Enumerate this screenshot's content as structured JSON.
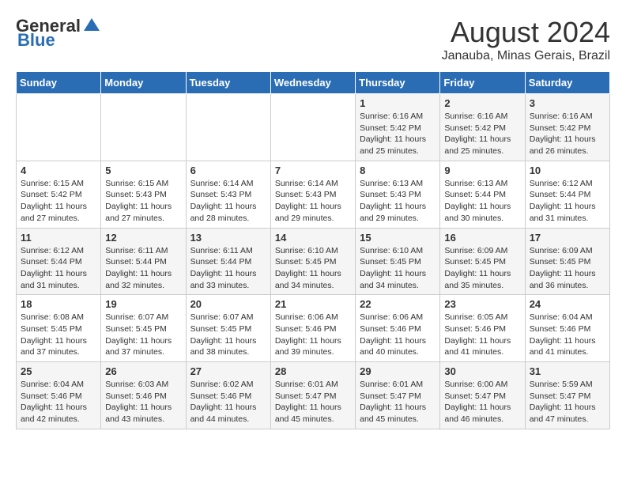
{
  "header": {
    "logo_general": "General",
    "logo_blue": "Blue",
    "month_year": "August 2024",
    "location": "Janauba, Minas Gerais, Brazil"
  },
  "days_of_week": [
    "Sunday",
    "Monday",
    "Tuesday",
    "Wednesday",
    "Thursday",
    "Friday",
    "Saturday"
  ],
  "weeks": [
    [
      {
        "day": "",
        "info": ""
      },
      {
        "day": "",
        "info": ""
      },
      {
        "day": "",
        "info": ""
      },
      {
        "day": "",
        "info": ""
      },
      {
        "day": "1",
        "info": "Sunrise: 6:16 AM\nSunset: 5:42 PM\nDaylight: 11 hours and 25 minutes."
      },
      {
        "day": "2",
        "info": "Sunrise: 6:16 AM\nSunset: 5:42 PM\nDaylight: 11 hours and 25 minutes."
      },
      {
        "day": "3",
        "info": "Sunrise: 6:16 AM\nSunset: 5:42 PM\nDaylight: 11 hours and 26 minutes."
      }
    ],
    [
      {
        "day": "4",
        "info": "Sunrise: 6:15 AM\nSunset: 5:42 PM\nDaylight: 11 hours and 27 minutes."
      },
      {
        "day": "5",
        "info": "Sunrise: 6:15 AM\nSunset: 5:43 PM\nDaylight: 11 hours and 27 minutes."
      },
      {
        "day": "6",
        "info": "Sunrise: 6:14 AM\nSunset: 5:43 PM\nDaylight: 11 hours and 28 minutes."
      },
      {
        "day": "7",
        "info": "Sunrise: 6:14 AM\nSunset: 5:43 PM\nDaylight: 11 hours and 29 minutes."
      },
      {
        "day": "8",
        "info": "Sunrise: 6:13 AM\nSunset: 5:43 PM\nDaylight: 11 hours and 29 minutes."
      },
      {
        "day": "9",
        "info": "Sunrise: 6:13 AM\nSunset: 5:44 PM\nDaylight: 11 hours and 30 minutes."
      },
      {
        "day": "10",
        "info": "Sunrise: 6:12 AM\nSunset: 5:44 PM\nDaylight: 11 hours and 31 minutes."
      }
    ],
    [
      {
        "day": "11",
        "info": "Sunrise: 6:12 AM\nSunset: 5:44 PM\nDaylight: 11 hours and 31 minutes."
      },
      {
        "day": "12",
        "info": "Sunrise: 6:11 AM\nSunset: 5:44 PM\nDaylight: 11 hours and 32 minutes."
      },
      {
        "day": "13",
        "info": "Sunrise: 6:11 AM\nSunset: 5:44 PM\nDaylight: 11 hours and 33 minutes."
      },
      {
        "day": "14",
        "info": "Sunrise: 6:10 AM\nSunset: 5:45 PM\nDaylight: 11 hours and 34 minutes."
      },
      {
        "day": "15",
        "info": "Sunrise: 6:10 AM\nSunset: 5:45 PM\nDaylight: 11 hours and 34 minutes."
      },
      {
        "day": "16",
        "info": "Sunrise: 6:09 AM\nSunset: 5:45 PM\nDaylight: 11 hours and 35 minutes."
      },
      {
        "day": "17",
        "info": "Sunrise: 6:09 AM\nSunset: 5:45 PM\nDaylight: 11 hours and 36 minutes."
      }
    ],
    [
      {
        "day": "18",
        "info": "Sunrise: 6:08 AM\nSunset: 5:45 PM\nDaylight: 11 hours and 37 minutes."
      },
      {
        "day": "19",
        "info": "Sunrise: 6:07 AM\nSunset: 5:45 PM\nDaylight: 11 hours and 37 minutes."
      },
      {
        "day": "20",
        "info": "Sunrise: 6:07 AM\nSunset: 5:45 PM\nDaylight: 11 hours and 38 minutes."
      },
      {
        "day": "21",
        "info": "Sunrise: 6:06 AM\nSunset: 5:46 PM\nDaylight: 11 hours and 39 minutes."
      },
      {
        "day": "22",
        "info": "Sunrise: 6:06 AM\nSunset: 5:46 PM\nDaylight: 11 hours and 40 minutes."
      },
      {
        "day": "23",
        "info": "Sunrise: 6:05 AM\nSunset: 5:46 PM\nDaylight: 11 hours and 41 minutes."
      },
      {
        "day": "24",
        "info": "Sunrise: 6:04 AM\nSunset: 5:46 PM\nDaylight: 11 hours and 41 minutes."
      }
    ],
    [
      {
        "day": "25",
        "info": "Sunrise: 6:04 AM\nSunset: 5:46 PM\nDaylight: 11 hours and 42 minutes."
      },
      {
        "day": "26",
        "info": "Sunrise: 6:03 AM\nSunset: 5:46 PM\nDaylight: 11 hours and 43 minutes."
      },
      {
        "day": "27",
        "info": "Sunrise: 6:02 AM\nSunset: 5:46 PM\nDaylight: 11 hours and 44 minutes."
      },
      {
        "day": "28",
        "info": "Sunrise: 6:01 AM\nSunset: 5:47 PM\nDaylight: 11 hours and 45 minutes."
      },
      {
        "day": "29",
        "info": "Sunrise: 6:01 AM\nSunset: 5:47 PM\nDaylight: 11 hours and 45 minutes."
      },
      {
        "day": "30",
        "info": "Sunrise: 6:00 AM\nSunset: 5:47 PM\nDaylight: 11 hours and 46 minutes."
      },
      {
        "day": "31",
        "info": "Sunrise: 5:59 AM\nSunset: 5:47 PM\nDaylight: 11 hours and 47 minutes."
      }
    ]
  ]
}
